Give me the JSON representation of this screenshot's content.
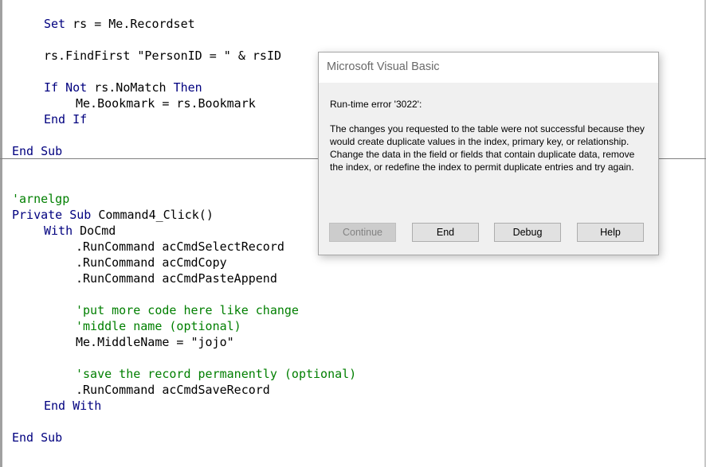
{
  "code": {
    "block1": {
      "set_kw": "Set",
      "set_rest": " rs = Me.Recordset",
      "findfirst": "rs.FindFirst \"PersonID = \" & rsID",
      "if_kw": "If",
      "not_kw": "Not",
      "nomatch": " rs.NoMatch ",
      "then_kw": "Then",
      "bookmark": "Me.Bookmark = rs.Bookmark",
      "end_if": "End If",
      "end_sub": "End Sub"
    },
    "block2": {
      "comment_author": "'arnelgp",
      "private_kw": "Private Sub",
      "proc_name": " Command4_Click()",
      "with_kw": "With",
      "with_obj": " DoCmd",
      "run1": ".RunCommand acCmdSelectRecord",
      "run2": ".RunCommand acCmdCopy",
      "run3": ".RunCommand acCmdPasteAppend",
      "comment1": "'put more code here like change",
      "comment2": "'middle name (optional)",
      "middlename": "Me.MiddleName = \"jojo\"",
      "comment3": "'save the record permanently (optional)",
      "run4": ".RunCommand acCmdSaveRecord",
      "end_with": "End With",
      "end_sub": "End Sub"
    }
  },
  "dialog": {
    "title": "Microsoft Visual Basic",
    "error_heading": "Run-time error '3022':",
    "error_message": "The changes you requested to the table were not successful because they would create duplicate values in the index, primary key, or relationship. Change the data in the field or fields that contain duplicate data, remove the index, or redefine the index to permit duplicate entries and try again.",
    "buttons": {
      "continue": "Continue",
      "end": "End",
      "debug": "Debug",
      "help": "Help"
    }
  },
  "colors": {
    "keyword": "#00007f",
    "comment": "#007f00",
    "identifier": "#000000"
  }
}
